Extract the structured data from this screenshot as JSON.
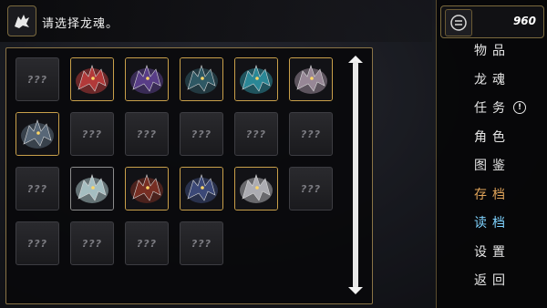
{
  "prompt": {
    "text": "请选择龙魂。"
  },
  "currency": {
    "value": "960",
    "icon": "coin-icon"
  },
  "grid": {
    "empty_label": "???",
    "slots": [
      {
        "state": "empty"
      },
      {
        "state": "filled",
        "icon": "red-dragon-icon",
        "color": "#b63a3a"
      },
      {
        "state": "filled",
        "icon": "purple-dragon-icon",
        "color": "#5a3f8a"
      },
      {
        "state": "filled",
        "icon": "teal-yellow-dragon-icon",
        "color": "#2f5a66"
      },
      {
        "state": "filled",
        "icon": "cyan-dragon-icon",
        "color": "#2b8a9a"
      },
      {
        "state": "filled",
        "icon": "white-red-dragon-icon",
        "color": "#9b8a9a"
      },
      {
        "state": "filled",
        "icon": "steel-dragon-icon",
        "color": "#5a6a7a"
      },
      {
        "state": "empty"
      },
      {
        "state": "empty"
      },
      {
        "state": "empty"
      },
      {
        "state": "empty"
      },
      {
        "state": "empty"
      },
      {
        "state": "empty"
      },
      {
        "state": "filled",
        "icon": "ice-dragon-icon",
        "color": "#a9c3c6",
        "silver": true
      },
      {
        "state": "filled",
        "icon": "crimson-dragon-icon",
        "color": "#7a2f24"
      },
      {
        "state": "filled",
        "icon": "dark-blue-dragon-icon",
        "color": "#3c4a7a"
      },
      {
        "state": "filled",
        "icon": "silver-dragon-icon",
        "color": "#b0b0b6"
      },
      {
        "state": "empty"
      },
      {
        "state": "empty"
      },
      {
        "state": "empty"
      },
      {
        "state": "empty"
      },
      {
        "state": "empty"
      }
    ]
  },
  "menu": {
    "items": [
      {
        "label": "物品"
      },
      {
        "label": "龙魂"
      },
      {
        "label": "任务",
        "alert": "!"
      },
      {
        "label": "角色"
      },
      {
        "label": "图鉴"
      },
      {
        "label": "存档"
      },
      {
        "label": "读档"
      },
      {
        "label": "设置"
      },
      {
        "label": "返回"
      }
    ]
  },
  "colors": {
    "accent_gold": "#c9a04a",
    "save": "#e0a45a",
    "load": "#7fd3ff"
  }
}
